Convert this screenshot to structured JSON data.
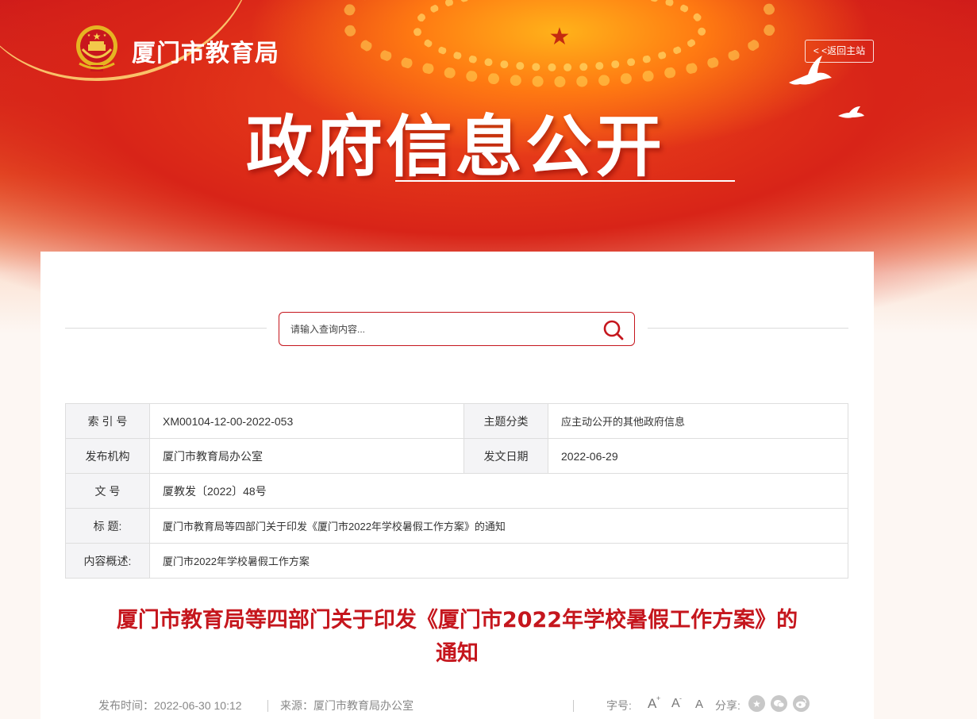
{
  "header": {
    "site_name": "厦门市教育局",
    "back_link_label": "< <返回主站",
    "hero_title": "政府信息公开"
  },
  "search": {
    "placeholder": "请输入查询内容..."
  },
  "info_table": {
    "index_label": "索 引 号",
    "index_value": "XM00104-12-00-2022-053",
    "topic_label": "主题分类",
    "topic_value": "应主动公开的其他政府信息",
    "publisher_label": "发布机构",
    "publisher_value": "厦门市教育局办公室",
    "date_label": "发文日期",
    "date_value": "2022-06-29",
    "doc_no_label": "文 号",
    "doc_no_value": "厦教发〔2022〕48号",
    "title_label": "标 题:",
    "title_value": "厦门市教育局等四部门关于印发《厦门市2022年学校暑假工作方案》的通知",
    "summary_label": "内容概述:",
    "summary_value": "厦门市2022年学校暑假工作方案"
  },
  "article": {
    "title_line1": "厦门市教育局等四部门关于印发《厦门市2022年学校暑假工作方案》的",
    "title_line2": "通知"
  },
  "meta": {
    "publish_time": "发布时间：2022-06-30 10:12",
    "source": "来源：厦门市教育局办公室",
    "font_size_label": "字号:",
    "font_large": "A",
    "font_medium": "A",
    "font_small": "A",
    "share_label": "分享:"
  },
  "colors": {
    "accent_red": "#c5161d",
    "banner_red": "#d82418"
  },
  "icons": {
    "search": "search-icon",
    "emblem": "national-emblem-icon",
    "share_star": "star-share-icon",
    "share_wechat": "wechat-icon",
    "share_weibo": "weibo-icon"
  }
}
